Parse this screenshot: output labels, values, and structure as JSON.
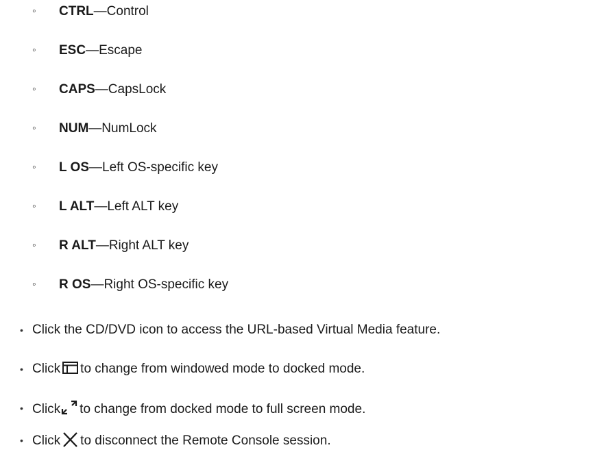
{
  "key_list": [
    {
      "key": "CTRL",
      "sep": "—",
      "desc": "Control"
    },
    {
      "key": "ESC",
      "sep": "—",
      "desc": "Escape"
    },
    {
      "key": "CAPS",
      "sep": "—",
      "desc": "CapsLock"
    },
    {
      "key": "NUM",
      "sep": "—",
      "desc": "NumLock"
    },
    {
      "key": "L OS",
      "sep": "—",
      "desc": "Left OS-specific key"
    },
    {
      "key": "L ALT",
      "sep": "—",
      "desc": "Left ALT key"
    },
    {
      "key": "R ALT",
      "sep": "—",
      "desc": "Right ALT key"
    },
    {
      "key": "R OS",
      "sep": "—",
      "desc": "Right OS-specific key"
    }
  ],
  "sub_bullet_glyph": "◦",
  "main_bullet_glyph": "•",
  "instructions": [
    {
      "before": "Click the CD/DVD icon to access the URL-based Virtual Media feature.",
      "icon": "",
      "after": ""
    },
    {
      "before": "Click",
      "icon": "docked-mode-icon",
      "after": "to change from windowed mode to docked mode."
    },
    {
      "before": "Click",
      "icon": "full-screen-icon",
      "after": "to change from docked mode to full screen mode."
    },
    {
      "before": "Click",
      "icon": "close-icon",
      "after": "to disconnect the Remote Console session."
    }
  ]
}
